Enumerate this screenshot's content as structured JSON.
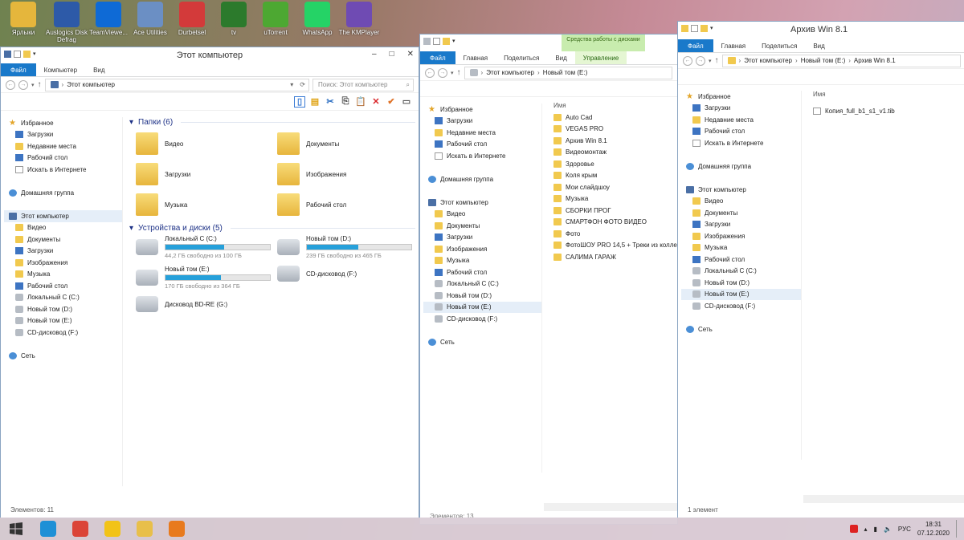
{
  "desktop": {
    "icons": [
      {
        "label": "Ярлыки",
        "name": "shortcuts-folder-icon",
        "color": "#e5b63c"
      },
      {
        "label": "Auslogics Disk Defrag",
        "name": "disk-defrag-icon",
        "color": "#2d5aa8"
      },
      {
        "label": "TeamViewe...",
        "name": "teamviewer-icon",
        "color": "#0e6ad6"
      },
      {
        "label": "Ace Utilities",
        "name": "ace-utilities-icon",
        "color": "#6b8fc4"
      },
      {
        "label": "Durbetsel",
        "name": "durbetsel-icon",
        "color": "#d33a3a"
      },
      {
        "label": "tv",
        "name": "tv-icon",
        "color": "#2c7a2c"
      },
      {
        "label": "uTorrent",
        "name": "utorrent-icon",
        "color": "#4da832"
      },
      {
        "label": "WhatsApp",
        "name": "whatsapp-icon",
        "color": "#25d366"
      },
      {
        "label": "The KMPlayer",
        "name": "kmplayer-icon",
        "color": "#6f4bb3"
      }
    ]
  },
  "win1": {
    "title": "Этот компьютер",
    "tabs": [
      "Файл",
      "Компьютер",
      "Вид"
    ],
    "path": [
      "Этот компьютер"
    ],
    "search_placeholder": "Поиск: Этот компьютер",
    "nav": [
      {
        "label": "Избранное",
        "icon": "star",
        "indent": 0
      },
      {
        "label": "Загрузки",
        "icon": "blue",
        "indent": 1
      },
      {
        "label": "Недавние места",
        "icon": "folder",
        "indent": 1
      },
      {
        "label": "Рабочий стол",
        "icon": "blue",
        "indent": 1
      },
      {
        "label": "Искать в Интернете",
        "icon": "doc",
        "indent": 1
      },
      {
        "label": "",
        "icon": "",
        "indent": 0
      },
      {
        "label": "Домашняя группа",
        "icon": "net",
        "indent": 0
      },
      {
        "label": "",
        "icon": "",
        "indent": 0
      },
      {
        "label": "Этот компьютер",
        "icon": "pc",
        "indent": 0,
        "selected": true
      },
      {
        "label": "Видео",
        "icon": "folder",
        "indent": 1
      },
      {
        "label": "Документы",
        "icon": "folder",
        "indent": 1
      },
      {
        "label": "Загрузки",
        "icon": "blue",
        "indent": 1
      },
      {
        "label": "Изображения",
        "icon": "folder",
        "indent": 1
      },
      {
        "label": "Музыка",
        "icon": "folder",
        "indent": 1
      },
      {
        "label": "Рабочий стол",
        "icon": "blue",
        "indent": 1
      },
      {
        "label": "Локальный С (C:)",
        "icon": "drive",
        "indent": 1
      },
      {
        "label": "Новый том (D:)",
        "icon": "drive",
        "indent": 1
      },
      {
        "label": "Новый том  (E:)",
        "icon": "drive",
        "indent": 1
      },
      {
        "label": "CD-дисковод (F:)",
        "icon": "drive",
        "indent": 1
      },
      {
        "label": "",
        "icon": "",
        "indent": 0
      },
      {
        "label": "Сеть",
        "icon": "net",
        "indent": 0
      }
    ],
    "folders_header": "Папки (6)",
    "folders": [
      "Видео",
      "Документы",
      "Загрузки",
      "Изображения",
      "Музыка",
      "Рабочий стол"
    ],
    "drives_header": "Устройства и диски (5)",
    "drives": [
      {
        "name": "Локальный С (C:)",
        "free": "44,2 ГБ свободно из 100 ГБ",
        "used": 0.56
      },
      {
        "name": "Новый том (D:)",
        "free": "239 ГБ свободно из 465 ГБ",
        "used": 0.49
      },
      {
        "name": "Новый том  (E:)",
        "free": "170 ГБ свободно из 364 ГБ",
        "used": 0.53
      },
      {
        "name": "CD-дисковод (F:)",
        "free": "",
        "used": null
      },
      {
        "name": "Дисковод BD-RE (G:)",
        "free": "",
        "used": null
      }
    ],
    "status": "Элементов: 11"
  },
  "win2": {
    "context_header": "Средства работы с дисками",
    "tabs": [
      "Файл",
      "Главная",
      "Поделиться",
      "Вид",
      "Управление"
    ],
    "path": [
      "Этот компьютер",
      "Новый том  (E:)"
    ],
    "nav": [
      {
        "label": "Избранное",
        "icon": "star",
        "indent": 0
      },
      {
        "label": "Загрузки",
        "icon": "blue",
        "indent": 1
      },
      {
        "label": "Недавние места",
        "icon": "folder",
        "indent": 1
      },
      {
        "label": "Рабочий стол",
        "icon": "blue",
        "indent": 1
      },
      {
        "label": "Искать в Интернете",
        "icon": "doc",
        "indent": 1
      },
      {
        "label": "",
        "icon": "",
        "indent": 0
      },
      {
        "label": "Домашняя группа",
        "icon": "net",
        "indent": 0
      },
      {
        "label": "",
        "icon": "",
        "indent": 0
      },
      {
        "label": "Этот компьютер",
        "icon": "pc",
        "indent": 0
      },
      {
        "label": "Видео",
        "icon": "folder",
        "indent": 1
      },
      {
        "label": "Документы",
        "icon": "folder",
        "indent": 1
      },
      {
        "label": "Загрузки",
        "icon": "blue",
        "indent": 1
      },
      {
        "label": "Изображения",
        "icon": "folder",
        "indent": 1
      },
      {
        "label": "Музыка",
        "icon": "folder",
        "indent": 1
      },
      {
        "label": "Рабочий стол",
        "icon": "blue",
        "indent": 1
      },
      {
        "label": "Локальный С (C:)",
        "icon": "drive",
        "indent": 1
      },
      {
        "label": "Новый том (D:)",
        "icon": "drive",
        "indent": 1
      },
      {
        "label": "Новый том  (E:)",
        "icon": "drive",
        "indent": 1,
        "selected": true
      },
      {
        "label": "CD-дисковод (F:)",
        "icon": "drive",
        "indent": 1
      },
      {
        "label": "",
        "icon": "",
        "indent": 0
      },
      {
        "label": "Сеть",
        "icon": "net",
        "indent": 0
      }
    ],
    "column": "Имя",
    "files": [
      "Auto Cad",
      "VEGAS PRO",
      "Архив Win 8.1",
      "Видеомонтаж",
      "Здоровье",
      "Коля крым",
      "Мои слайдшоу",
      "Музыка",
      "СБОРКИ ПРОГ",
      "СМАРТФОН ФОТО ВИДЕО",
      "Фото",
      "ФотоШОУ PRO 14,5 + Треки из колле",
      "САЛИМА ГАРАЖ"
    ],
    "status": "Элементов: 13"
  },
  "win3": {
    "title": "Архив Win 8.1",
    "tabs": [
      "Файл",
      "Главная",
      "Поделиться",
      "Вид"
    ],
    "path": [
      "Этот компьютер",
      "Новый том  (E:)",
      "Архив Win 8.1"
    ],
    "nav": [
      {
        "label": "Избранное",
        "icon": "star",
        "indent": 0
      },
      {
        "label": "Загрузки",
        "icon": "blue",
        "indent": 1
      },
      {
        "label": "Недавние места",
        "icon": "folder",
        "indent": 1
      },
      {
        "label": "Рабочий стол",
        "icon": "blue",
        "indent": 1
      },
      {
        "label": "Искать в Интернете",
        "icon": "doc",
        "indent": 1
      },
      {
        "label": "",
        "icon": "",
        "indent": 0
      },
      {
        "label": "Домашняя группа",
        "icon": "net",
        "indent": 0
      },
      {
        "label": "",
        "icon": "",
        "indent": 0
      },
      {
        "label": "Этот компьютер",
        "icon": "pc",
        "indent": 0
      },
      {
        "label": "Видео",
        "icon": "folder",
        "indent": 1
      },
      {
        "label": "Документы",
        "icon": "folder",
        "indent": 1
      },
      {
        "label": "Загрузки",
        "icon": "blue",
        "indent": 1
      },
      {
        "label": "Изображения",
        "icon": "folder",
        "indent": 1
      },
      {
        "label": "Музыка",
        "icon": "folder",
        "indent": 1
      },
      {
        "label": "Рабочий стол",
        "icon": "blue",
        "indent": 1
      },
      {
        "label": "Локальный С (C:)",
        "icon": "drive",
        "indent": 1
      },
      {
        "label": "Новый том (D:)",
        "icon": "drive",
        "indent": 1
      },
      {
        "label": "Новый том  (E:)",
        "icon": "drive",
        "indent": 1,
        "selected": true
      },
      {
        "label": "CD-дисковод (F:)",
        "icon": "drive",
        "indent": 1
      },
      {
        "label": "",
        "icon": "",
        "indent": 0
      },
      {
        "label": "Сеть",
        "icon": "net",
        "indent": 0
      }
    ],
    "column": "Имя",
    "files": [
      "Копия_full_b1_s1_v1.tib"
    ],
    "status": "1 элемент"
  },
  "taskbar": {
    "apps": [
      {
        "name": "internet-explorer-icon",
        "color": "#1e90d6"
      },
      {
        "name": "chrome-icon",
        "color": "#db4437"
      },
      {
        "name": "batman-app-icon",
        "color": "#f2c318"
      },
      {
        "name": "file-explorer-icon",
        "color": "#e8bf4a"
      },
      {
        "name": "media-player-icon",
        "color": "#e87a1e"
      }
    ],
    "language": "РУС",
    "time": "18:31",
    "date": "07.12.2020"
  }
}
